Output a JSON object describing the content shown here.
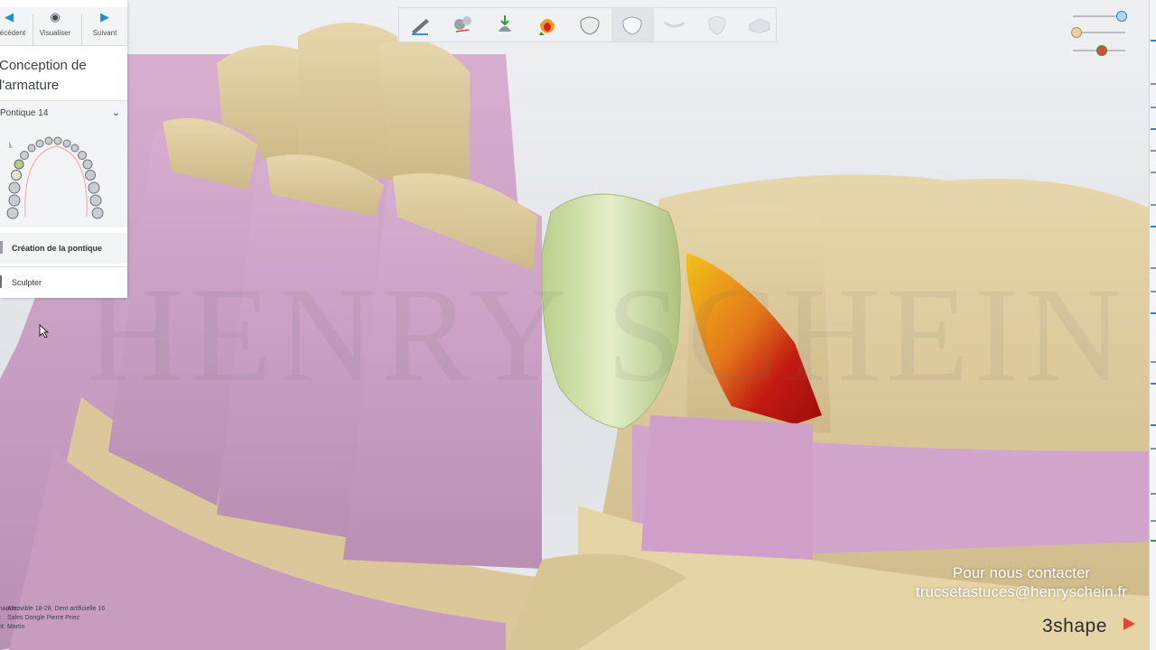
{
  "nav": {
    "prev_label": "Précédent",
    "view_label": "Visualiser",
    "next_label": "Suivant"
  },
  "panel": {
    "title": "Conception de l'armature",
    "pontic_select": "Pontique 14",
    "steps": [
      "Création de la pontique",
      "Sculpter"
    ]
  },
  "toolbar": {
    "tools": [
      "prep-tool-icon",
      "cut-tool-icon",
      "place-tool-icon",
      "color-map-icon",
      "crown-icon",
      "crown-active-icon",
      "connector-icon",
      "tooth-outline-icon",
      "block-icon"
    ],
    "active_index": 5
  },
  "sliders": {
    "colors": [
      "#1b8fd6",
      "#d9c07c",
      "#e04a2f"
    ]
  },
  "info": {
    "rows": [
      {
        "key": "Commande:",
        "value": "Amovible 18-28, Dent artificielle 16"
      },
      {
        "key": "Client:",
        "value": "Sales Dongle Pierre Priez"
      },
      {
        "key": "Patient:",
        "value": "Martin"
      }
    ]
  },
  "watermark": "HENRY SCHEIN",
  "contact": {
    "line1": "Pour nous contacter",
    "line2": "trucsetastuces@henryschein.fr"
  },
  "brand": "3shape",
  "colors": {
    "gingiva": "#cfa2c7",
    "stone": "#dcc99c",
    "pontic": "#cfe0a8",
    "accent": "#1b8fd6"
  }
}
